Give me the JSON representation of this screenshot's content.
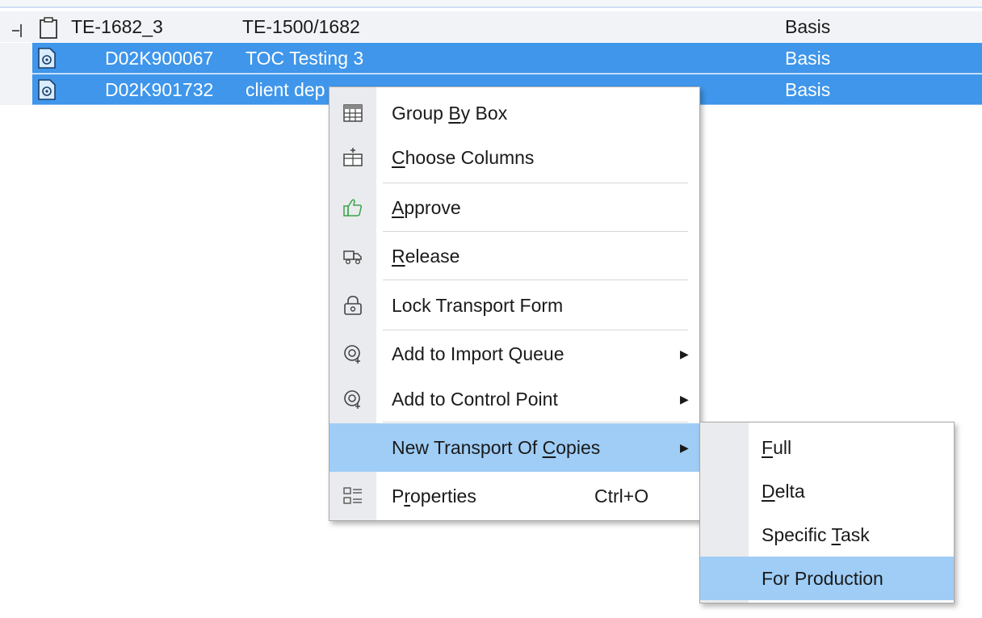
{
  "tree": {
    "parent": {
      "id": "TE-1682_3",
      "ref": "TE-1500/1682",
      "category": "Basis"
    },
    "children": [
      {
        "id": "D02K900067",
        "description": "TOC Testing 3",
        "category": "Basis"
      },
      {
        "id": "D02K901732",
        "description": "client dep",
        "category": "Basis"
      }
    ]
  },
  "context_menu": {
    "group_by_box": {
      "pre": "Group ",
      "acc": "B",
      "post": "y Box"
    },
    "choose_columns": {
      "pre": "",
      "acc": "C",
      "post": "hoose Columns"
    },
    "approve": {
      "pre": "",
      "acc": "A",
      "post": "pprove"
    },
    "release": {
      "pre": "",
      "acc": "R",
      "post": "elease"
    },
    "lock_transport_form": {
      "label": "Lock Transport Form"
    },
    "add_to_import_queue": {
      "label": "Add to Import Queue"
    },
    "add_to_control_point": {
      "label": "Add to Control Point"
    },
    "new_transport_of_copies": {
      "pre": "New Transport Of ",
      "acc": "C",
      "post": "opies"
    },
    "properties": {
      "pre": "P",
      "acc": "r",
      "post": "operties",
      "shortcut": "Ctrl+O"
    },
    "submenu_arrow": "▶"
  },
  "submenu": {
    "full": {
      "pre": "",
      "acc": "F",
      "post": "ull"
    },
    "delta": {
      "pre": "",
      "acc": "D",
      "post": "elta"
    },
    "specific_task": {
      "pre": "Specific ",
      "acc": "T",
      "post": "ask"
    },
    "for_production": {
      "label": "For Production"
    }
  },
  "colors": {
    "selection": "#3f96ea",
    "menu_highlight": "#9fcdf6",
    "gutter": "#e9ebee"
  }
}
